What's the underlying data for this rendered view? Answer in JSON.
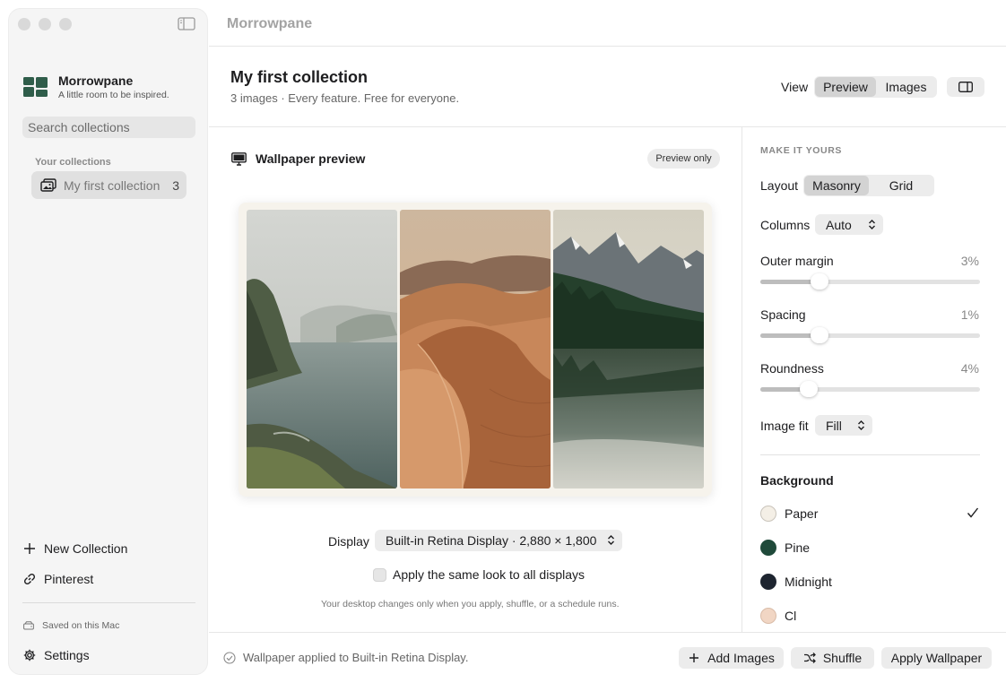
{
  "app": {
    "title": "Morrowpane",
    "tagline": "A little room to be inspired."
  },
  "sidebar": {
    "search_placeholder": "Search collections",
    "section_label": "Your collections",
    "collections": [
      {
        "label": "My first collection",
        "count": "3"
      }
    ],
    "new_collection": "New Collection",
    "pinterest": "Pinterest",
    "saved_note": "Saved on this Mac",
    "settings": "Settings"
  },
  "header": {
    "collection_title": "My first collection",
    "collection_subtitle": "3 images · Every feature. Free for everyone.",
    "view_label": "View",
    "view_options": [
      "Preview",
      "Images"
    ],
    "view_selected": "Preview"
  },
  "preview": {
    "title": "Wallpaper preview",
    "badge": "Preview only",
    "display_label": "Display",
    "display_value": "Built-in Retina Display · 2,880 × 1,800",
    "apply_all_label": "Apply the same look to all displays",
    "apply_all_checked": false,
    "hint": "Your desktop changes only when you apply, shuffle, or a schedule runs."
  },
  "customize": {
    "section_label": "MAKE IT YOURS",
    "layout_label": "Layout",
    "layout_options": [
      "Masonry",
      "Grid"
    ],
    "layout_selected": "Masonry",
    "columns_label": "Columns",
    "columns_value": "Auto",
    "outer_margin": {
      "label": "Outer margin",
      "value": "3%",
      "level": 0.27
    },
    "spacing": {
      "label": "Spacing",
      "value": "1%",
      "level": 0.27
    },
    "roundness": {
      "label": "Roundness",
      "value": "4%",
      "level": 0.22
    },
    "image_fit_label": "Image fit",
    "image_fit_value": "Fill",
    "background_label": "Background",
    "background_options": [
      {
        "label": "Paper",
        "color": "#f4efe6",
        "selected": true
      },
      {
        "label": "Pine",
        "color": "#1f4a3a"
      },
      {
        "label": "Midnight",
        "color": "#1e2530"
      },
      {
        "label": "Cl",
        "color": "#f1d6c4"
      }
    ]
  },
  "footer": {
    "status": "Wallpaper applied to Built-in Retina Display.",
    "add_images": "Add Images",
    "shuffle": "Shuffle",
    "apply_wallpaper": "Apply Wallpaper"
  },
  "colors": {
    "sidebar_bg": "#f5f5f5",
    "selected_bg": "#d3d3d3",
    "brand_green": "#2f5d4a"
  }
}
